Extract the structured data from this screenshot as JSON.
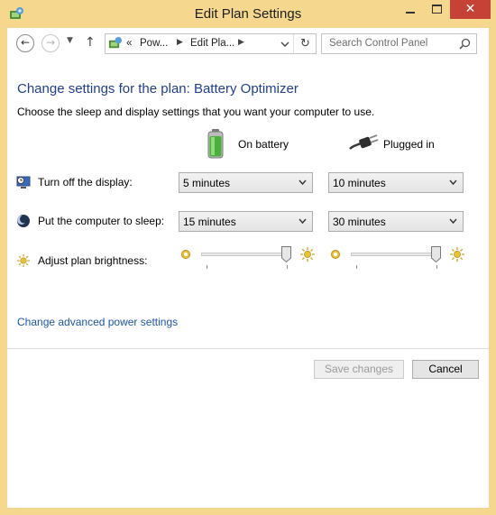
{
  "window": {
    "title": "Edit Plan Settings",
    "close_glyph": "✕",
    "accent_color": "#f5d78e",
    "close_color": "#c74236"
  },
  "nav": {
    "back_glyph": "←",
    "forward_glyph": "→",
    "recent_glyph": "▼",
    "up_glyph": "↑",
    "breadcrumb_prefix": "«",
    "breadcrumb": [
      "Pow...",
      "Edit Pla..."
    ],
    "separator_glyph": "▶",
    "refresh_glyph": "↻",
    "search_placeholder": "Search Control Panel",
    "icons": [
      "back-arrow-icon",
      "forward-arrow-icon",
      "up-arrow-icon",
      "power-options-icon",
      "chevron-down-icon",
      "refresh-icon",
      "search-icon"
    ]
  },
  "main": {
    "heading": "Change settings for the plan: Battery Optimizer",
    "description": "Choose the sleep and display settings that you want your computer to use.",
    "columns": {
      "battery": "On battery",
      "plugged": "Plugged in"
    },
    "rows": {
      "display": {
        "label": "Turn off the display:",
        "battery": "5 minutes",
        "plugged": "10 minutes"
      },
      "sleep": {
        "label": "Put the computer to sleep:",
        "battery": "15 minutes",
        "plugged": "30 minutes"
      },
      "brightness": {
        "label": "Adjust plan brightness:",
        "battery_level_percent": 100,
        "plugged_level_percent": 100
      }
    },
    "advanced_link": "Change advanced power settings"
  },
  "buttons": {
    "save": "Save changes",
    "cancel": "Cancel"
  }
}
